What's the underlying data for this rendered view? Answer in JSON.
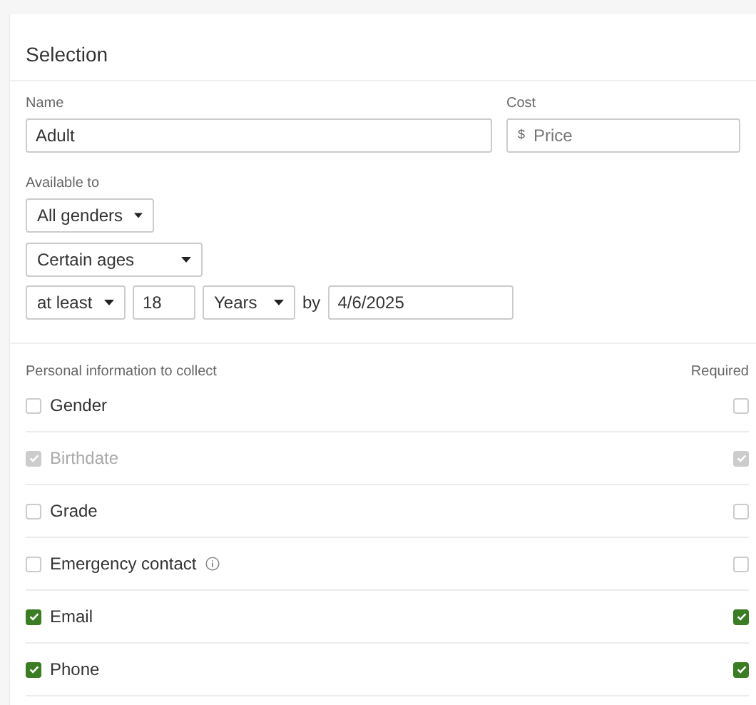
{
  "card": {
    "title": "Selection"
  },
  "name_field": {
    "label": "Name",
    "value": "Adult"
  },
  "cost_field": {
    "label": "Cost",
    "prefix": "$",
    "placeholder": "Price"
  },
  "availability": {
    "label": "Available to",
    "gender": "All genders",
    "ages": "Certain ages",
    "comparison": "at least",
    "age": "18",
    "unit": "Years",
    "by_label": "by",
    "date": "4/6/2025"
  },
  "info": {
    "header": "Personal information to collect",
    "required_header": "Required",
    "items": [
      {
        "label": "Gender",
        "checked": false,
        "required": false,
        "disabled": false,
        "info_icon": false
      },
      {
        "label": "Birthdate",
        "checked": true,
        "required": true,
        "disabled": true,
        "info_icon": false
      },
      {
        "label": "Grade",
        "checked": false,
        "required": false,
        "disabled": false,
        "info_icon": false
      },
      {
        "label": "Emergency contact",
        "checked": false,
        "required": false,
        "disabled": false,
        "info_icon": true
      },
      {
        "label": "Email",
        "checked": true,
        "required": true,
        "disabled": false,
        "info_icon": false
      },
      {
        "label": "Phone",
        "checked": true,
        "required": true,
        "disabled": false,
        "info_icon": false
      }
    ]
  }
}
